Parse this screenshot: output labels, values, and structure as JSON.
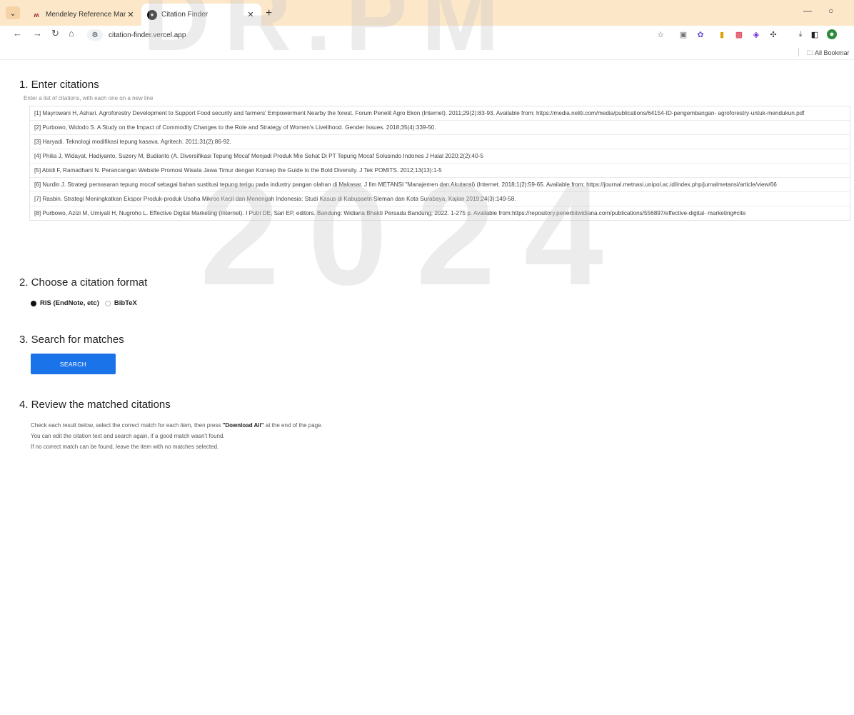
{
  "browser": {
    "tabs": [
      {
        "title": "Mendeley Reference Manager",
        "active": false,
        "icon": "mendeley-icon"
      },
      {
        "title": "Citation Finder",
        "active": true,
        "icon": "citation-finder-icon"
      }
    ],
    "url": "citation-finder.vercel.app",
    "bookmarks_label": "All Bookmar",
    "accent_color": "#fce7c9"
  },
  "section1": {
    "title": "1. Enter citations",
    "helper": "Enter a list of citations, with each one on a new line",
    "citations": [
      "[1]   Mayrowani H, Ashari. Agroforestry Development to Support Food security and farmers' Empowerment Nearby the forest. Forum Penelit Agro Ekon (Internet). 2011;29(2):83-93. Available from: https://media.neliti.com/media/publications/64154-ID-pengembangan- agroforestry-untuk-mendukun.pdf",
      "[2]   Purbowo, Widodo S. A Study on the Impact of Commodity Changes to the Role and Strategy of Women's Livelihood. Gender Issues. 2018;35(4):339-50.",
      "[3]   Haryadi. Teknologi modifikasi tepung kasava. Agritech. 2011;31(2):86-92.",
      "[4]   Philia J, Widayat, Hadiyanto, Suzery M, Budianto (A. Diversifikasi Tepung Mocaf Menjadi Produk Mie Sehat Di PT Tepung Mocaf Solusindo Indones J Halal 2020;2(2):40-5",
      "[5]   Abidi F, Ramadhani N. Perancangan Website Promosi Wisata Jawa Timur dengan Konsep the Guide to the Bold Diversity. J Tek POMITS. 2012;13(13):1-5",
      "[6]   Nurdin J. Strategi pemasaran tepung mocaf sebagai bahan sustitusi tepung terigu pada industry pangan olahan di Makasar. J Ilm METANSI \"Manajemen dan Akutansi) (Internet. 2018;1(2):59-65.   Available  from: https://journal.metnasi.unipol.ac.id/index.php/jurnalmetansi/article/view/66",
      "[7]   Rasbin. Strategi Meningkatkan Ekspor Produk-produk Usaha Mikroo Kecil dan Menengah Indonesia: Studi Kasus di Kabupaetn Sleman dan Kota Surabaya. Kajian 2019;24(3):149-58.",
      "[8]   Purbowo, Azizi M, Umiyati H, Nugroho L. Effective Digital Marketing (Internet). I Putri DE, Sari EP, editors. Bandung: Widiana Bhakti Persada Bandung; 2022. 1-275 p. Available from:https://repository.penerbitwidiana.com/publications/556897/effective-digital- marketing#cite"
    ]
  },
  "section2": {
    "title": "2. Choose a citation format",
    "options": [
      {
        "label": "RIS (EndNote, etc)",
        "selected": true
      },
      {
        "label": "BibTeX",
        "selected": false
      }
    ]
  },
  "section3": {
    "title": "3. Search for matches",
    "button_label": "SEARCH"
  },
  "section4": {
    "title": "4. Review the matched citations",
    "line1_pre": "Check each result below, select the correct match for each item, then press ",
    "line1_bold": "\"Download All\"",
    "line1_post": " at the end of the page.",
    "line2": "You can edit the citation text and search again, if a good match wasn't found.",
    "line3": "If no correct match can be found, leave the item with no matches selected."
  },
  "watermark": {
    "line1": "DR.PM",
    "line2": "2024"
  }
}
